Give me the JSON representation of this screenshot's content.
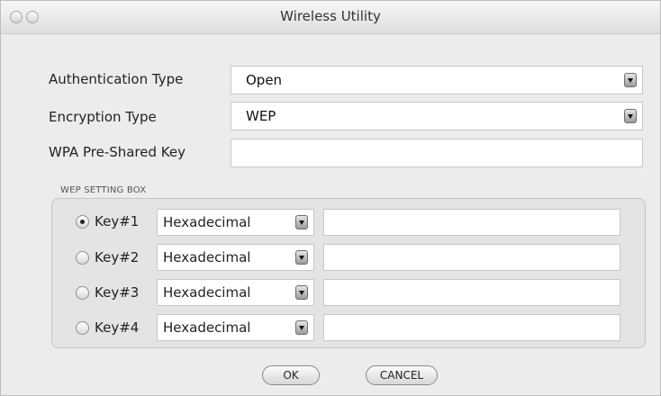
{
  "window": {
    "title": "Wireless Utility"
  },
  "fields": {
    "auth_label": "Authentication Type",
    "auth_value": "Open",
    "enc_label": "Encryption Type",
    "enc_value": "WEP",
    "wpa_label": "WPA Pre-Shared Key",
    "wpa_value": ""
  },
  "wep_box": {
    "title": "WEP SETTING BOX",
    "keys": [
      {
        "label": "Key#1",
        "format": "Hexadecimal",
        "selected": true,
        "value": ""
      },
      {
        "label": "Key#2",
        "format": "Hexadecimal",
        "selected": false,
        "value": ""
      },
      {
        "label": "Key#3",
        "format": "Hexadecimal",
        "selected": false,
        "value": ""
      },
      {
        "label": "Key#4",
        "format": "Hexadecimal",
        "selected": false,
        "value": ""
      }
    ]
  },
  "buttons": {
    "ok": "OK",
    "cancel": "CANCEL"
  },
  "icons": {
    "close": "close-icon",
    "minimize": "minimize-icon",
    "dropdown": "chevron-down-icon"
  }
}
